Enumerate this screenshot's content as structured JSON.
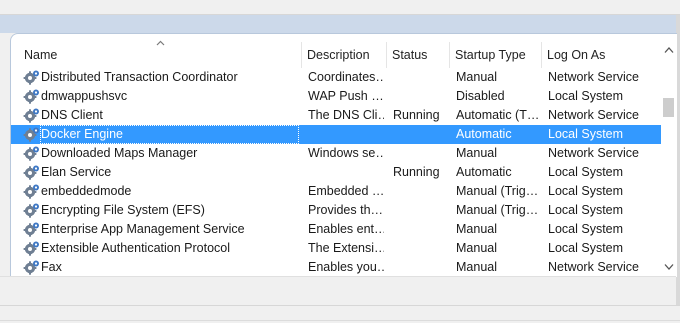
{
  "columns": {
    "name": "Name",
    "description": "Description",
    "status": "Status",
    "startup_type": "Startup Type",
    "log_on_as": "Log On As"
  },
  "icons": {
    "service": "gear-icon",
    "sort": "sort-ascending-icon"
  },
  "colors": {
    "selection": "#3399ff",
    "header_band": "#ccd9ea"
  },
  "services": [
    {
      "name": "Distributed Transaction Coordinator",
      "description": "Coordinates…",
      "status": "",
      "startup": "Manual",
      "logon": "Network Service",
      "selected": false
    },
    {
      "name": "dmwappushsvc",
      "description": "WAP Push …",
      "status": "",
      "startup": "Disabled",
      "logon": "Local System",
      "selected": false
    },
    {
      "name": "DNS Client",
      "description": "The DNS Cli…",
      "status": "Running",
      "startup": "Automatic (T…",
      "logon": "Network Service",
      "selected": false
    },
    {
      "name": "Docker Engine",
      "description": "",
      "status": "",
      "startup": "Automatic",
      "logon": "Local System",
      "selected": true
    },
    {
      "name": "Downloaded Maps Manager",
      "description": "Windows se…",
      "status": "",
      "startup": "Manual",
      "logon": "Network Service",
      "selected": false
    },
    {
      "name": "Elan Service",
      "description": "",
      "status": "Running",
      "startup": "Automatic",
      "logon": "Local System",
      "selected": false
    },
    {
      "name": "embeddedmode",
      "description": "Embedded …",
      "status": "",
      "startup": "Manual (Trig…",
      "logon": "Local System",
      "selected": false
    },
    {
      "name": "Encrypting File System (EFS)",
      "description": "Provides th…",
      "status": "",
      "startup": "Manual (Trig…",
      "logon": "Local System",
      "selected": false
    },
    {
      "name": "Enterprise App Management Service",
      "description": "Enables ent…",
      "status": "",
      "startup": "Manual",
      "logon": "Local System",
      "selected": false
    },
    {
      "name": "Extensible Authentication Protocol",
      "description": "The Extensi…",
      "status": "",
      "startup": "Manual",
      "logon": "Local System",
      "selected": false
    },
    {
      "name": "Fax",
      "description": "Enables you…",
      "status": "",
      "startup": "Manual",
      "logon": "Network Service",
      "selected": false
    }
  ]
}
